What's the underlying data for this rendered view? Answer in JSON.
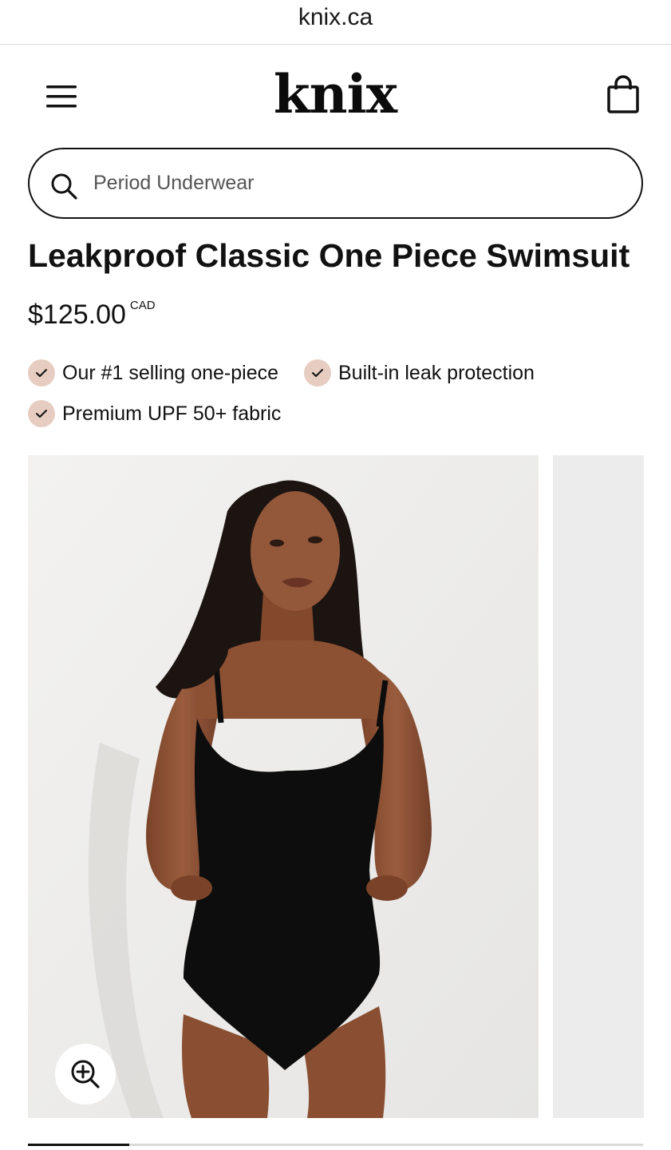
{
  "browser": {
    "url": "knix.ca"
  },
  "header": {
    "menu_icon": "hamburger-menu-icon",
    "logo": "knix",
    "cart_icon": "shopping-bag-icon"
  },
  "search": {
    "placeholder": "Period Underwear",
    "value": "",
    "icon": "search-icon"
  },
  "product": {
    "title": "Leakproof Classic One Piece Swimsuit",
    "price": "$125.00",
    "currency": "CAD",
    "features": [
      {
        "label": "Our #1 selling one-piece",
        "icon": "check-icon"
      },
      {
        "label": "Built-in leak protection",
        "icon": "check-icon"
      },
      {
        "label": "Premium UPF 50+ fabric",
        "icon": "check-icon"
      }
    ]
  },
  "gallery": {
    "image_subject": "model wearing black scoop-neck one piece swimsuit",
    "zoom_icon": "zoom-in-icon",
    "progress_fraction": 0.165
  },
  "colors": {
    "text": "#111111",
    "badge": "#e7cdc1",
    "image_bg": "#ecebea",
    "swimsuit": "#0d0d0d",
    "skin": "#8a5136"
  }
}
